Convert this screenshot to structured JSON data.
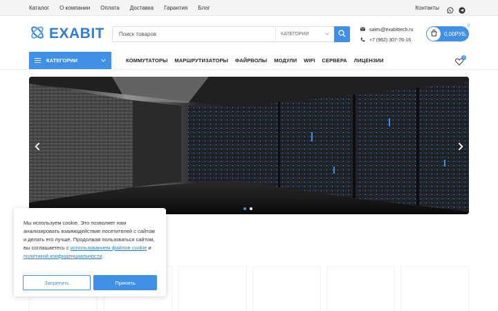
{
  "topbar": {
    "links": [
      "Каталог",
      "О компании",
      "Оплата",
      "Доставка",
      "Гарантия",
      "Блог"
    ],
    "contacts_label": "Контакты"
  },
  "header": {
    "logo_text": "EXABIT",
    "search_placeholder": "Поиск товаров",
    "category_select": "КАТЕГОРИИ",
    "email": "sales@exabittech.ru",
    "phone": "+7 (962) 307-76-16",
    "cart_total": "0,00РУБ.",
    "cart_count": "0"
  },
  "nav": {
    "categories_button": "КАТЕГОРИИ",
    "items": [
      "КОММУТАТОРЫ",
      "МАРШРУТИЗАТОРЫ",
      "ФАЙРВОЛЫ",
      "МОДУЛИ",
      "WIFI",
      "СЕРВЕРА",
      "ЛИЦЕНЗИИ"
    ],
    "wishlist_count": "0"
  },
  "slider": {
    "slide_count": 2,
    "active_index": 0
  },
  "cookie": {
    "text_before": "Мы используем cookie. Это позволяет нам анализировать взаимодействие посетителей с сайтом и делать его лучше. Продолжая пользоваться сайтом, вы соглашаетесь с ",
    "link1": "использованием файлов cookie",
    "text_middle": " и ",
    "link2": "политикой конфиденциальности",
    "text_after": ".",
    "reject_label": "Запретить",
    "accept_label": "Принять"
  },
  "colors": {
    "accent": "#3f90e6",
    "topbar_bg": "#f4f4f4",
    "banner_bg": "#0c0c0c"
  }
}
